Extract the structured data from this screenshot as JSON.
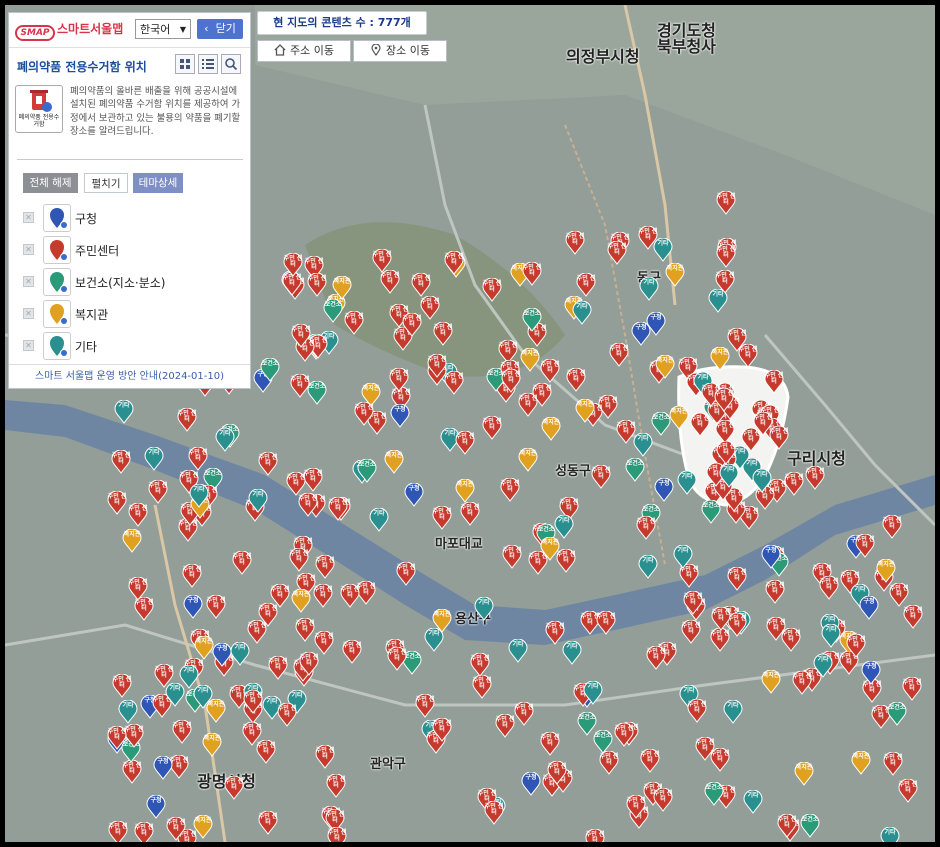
{
  "app": {
    "logo_mark": "SMAP",
    "logo_text": "스마트서울맵",
    "language": "한국어",
    "close_label": "닫기"
  },
  "map": {
    "content_count": "현 지도의 콘텐츠 수 : 777개",
    "address_move": "주소 이동",
    "place_move": "장소 이동",
    "labels": [
      {
        "text": "경기도청",
        "cls": "big"
      },
      {
        "text": "북부청사",
        "cls": "big"
      },
      {
        "text": "의정부시청",
        "cls": "big"
      },
      {
        "text": "구리시청",
        "cls": "big"
      },
      {
        "text": "광명시청",
        "cls": "big"
      },
      {
        "text": "동구",
        "cls": ""
      },
      {
        "text": "마포대교",
        "cls": ""
      },
      {
        "text": "용산구",
        "cls": ""
      },
      {
        "text": "관악구",
        "cls": ""
      },
      {
        "text": "성동구",
        "cls": ""
      }
    ]
  },
  "panel": {
    "title": "폐의약품 전용수거함 위치",
    "thumb_label": "폐의약품 전용수거함",
    "description": "폐의약품의 올바른 배출을 위해 공공시설에 설치된 폐의약품 수거함 위치를 제공하여 가정에서 보관하고 있는 불용의 약품을 폐기할 장소를 알려드립니다.",
    "buttons": {
      "clear_all": "전체 해제",
      "expand": "펼치기",
      "theme_detail": "테마상세"
    },
    "categories": [
      {
        "name": "구청",
        "color": "#2f55b5",
        "icon": "building-icon",
        "tag": "구청"
      },
      {
        "name": "주민센터",
        "color": "#c63a2e",
        "icon": "community-center-icon",
        "tag": "주민\n센터"
      },
      {
        "name": "보건소(지소·분소)",
        "color": "#2a9a78",
        "icon": "health-center-icon",
        "tag": "보건소"
      },
      {
        "name": "복지관",
        "color": "#e0a020",
        "icon": "welfare-icon",
        "tag": "복지관"
      },
      {
        "name": "기타",
        "color": "#2a8f8f",
        "icon": "etc-icon",
        "tag": "기타"
      }
    ],
    "notice": "스마트 서울맵 운영 방안 안내(2024-01-10)"
  }
}
